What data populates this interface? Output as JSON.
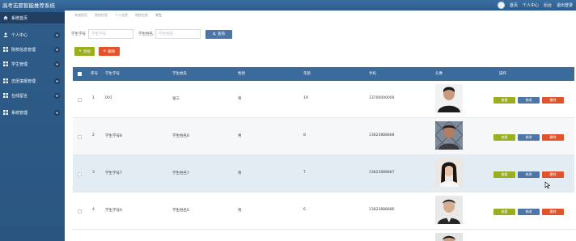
{
  "app": {
    "title": "高考志愿智能推荐系统"
  },
  "topbar": {
    "home": "首页",
    "profile": "个人中心",
    "admin": "后台",
    "logout": "退出登录"
  },
  "sidebar": {
    "items": [
      {
        "label": "系统首页",
        "icon": "home-icon"
      },
      {
        "label": "个人中心",
        "icon": "user-icon"
      },
      {
        "label": "院校信息管理",
        "icon": "grid-icon"
      },
      {
        "label": "学生管理",
        "icon": "grid-icon"
      },
      {
        "label": "志愿填报管理",
        "icon": "grid-icon"
      },
      {
        "label": "在线留言",
        "icon": "grid-icon"
      },
      {
        "label": "系统管理",
        "icon": "grid-icon"
      }
    ]
  },
  "breadcrumb": [
    "系统首页",
    "院校信息",
    "个人信息",
    "院校信息",
    "学生"
  ],
  "search": {
    "field1_label": "学生学号",
    "field1_placeholder": "学生学号",
    "field2_label": "学生姓名",
    "field2_placeholder": "学生姓名",
    "button": "查询"
  },
  "actions": {
    "add": "添加",
    "delete": "删除"
  },
  "table": {
    "headers": [
      "序号",
      "学生学号",
      "学生姓名",
      "性别",
      "年龄",
      "手机",
      "头像",
      "操作"
    ],
    "rows": [
      {
        "index": "1",
        "student_id": "001",
        "name": "张三",
        "gender": "男",
        "age": "19",
        "phone": "13700000000"
      },
      {
        "index": "2",
        "student_id": "学生学号8",
        "name": "学生姓名8",
        "gender": "男",
        "age": "8",
        "phone": "13823888888"
      },
      {
        "index": "3",
        "student_id": "学生学号7",
        "name": "学生姓名7",
        "gender": "男",
        "age": "7",
        "phone": "13823888887"
      },
      {
        "index": "4",
        "student_id": "学生学号6",
        "name": "学生姓名6",
        "gender": "男",
        "age": "6",
        "phone": "13823888886"
      }
    ],
    "ops": {
      "view": "查看",
      "edit": "修改",
      "remove": "删除"
    }
  },
  "colors": {
    "sidebar": "#2e5c89",
    "header": "#3b6a9c",
    "view": "#9aae1f",
    "edit": "#4d75a6",
    "remove": "#e0532b"
  }
}
